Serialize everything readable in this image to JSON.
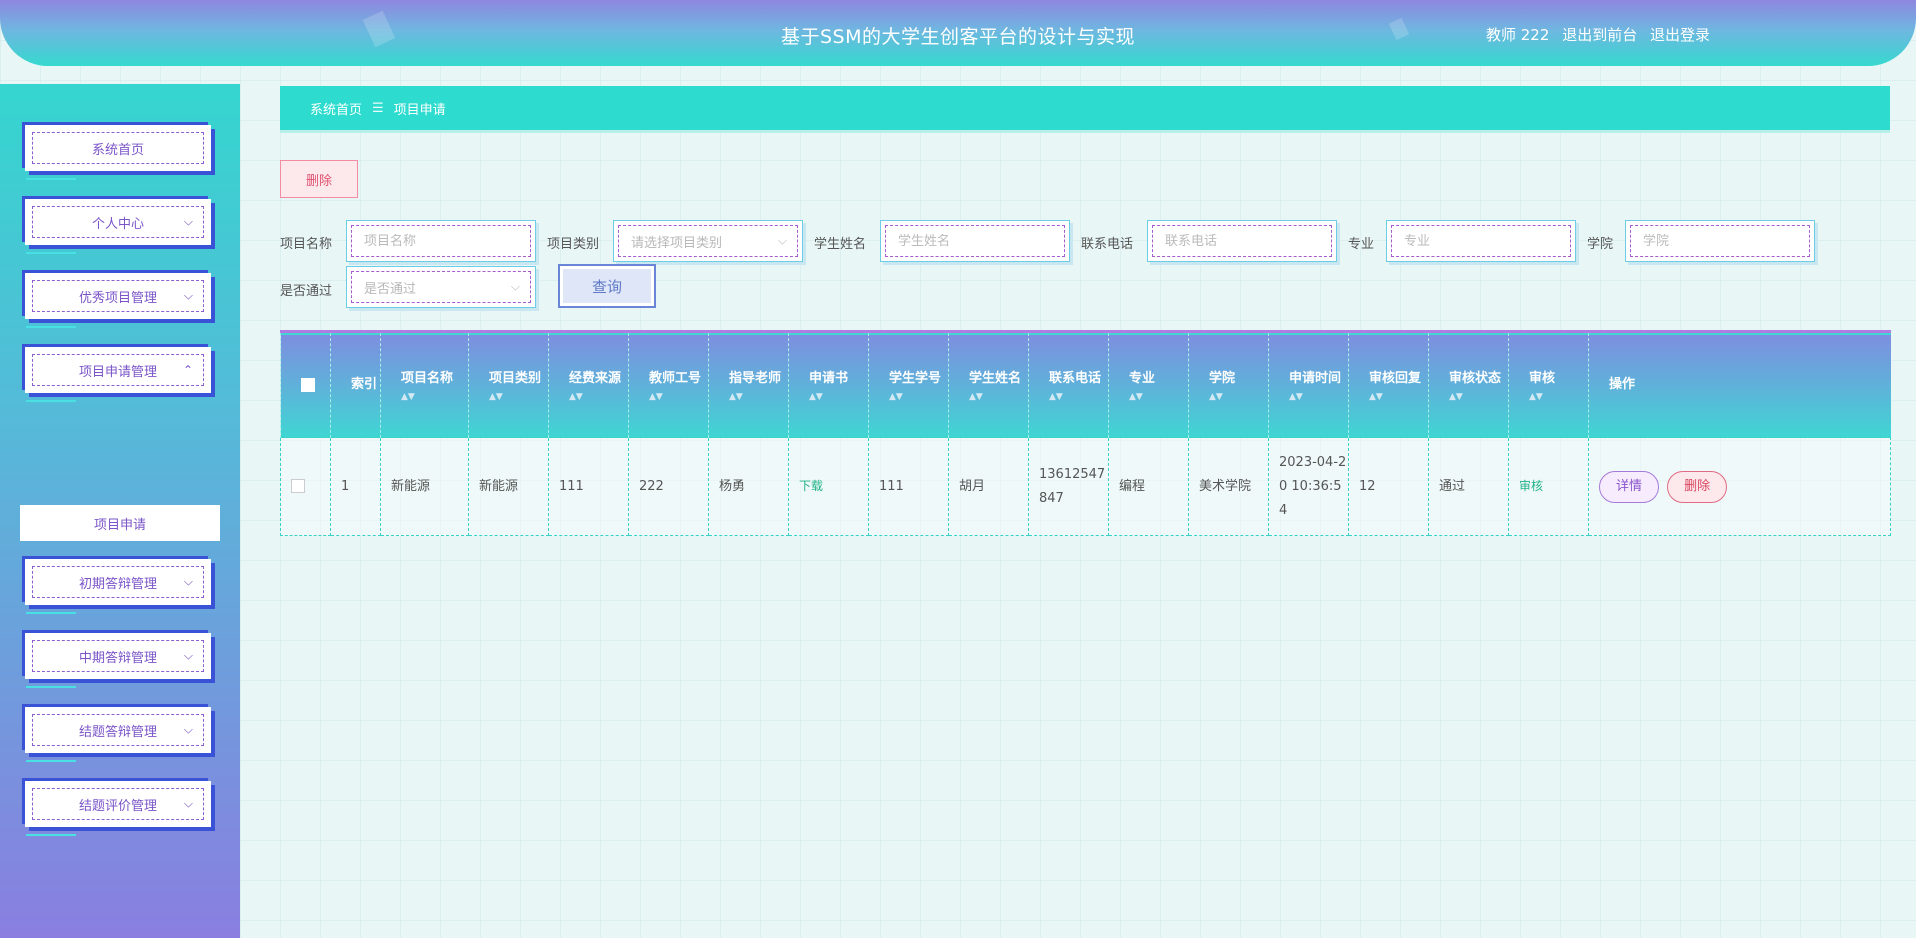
{
  "header": {
    "title": "基于SSM的大学生创客平台的设计与实现",
    "user": "教师 222",
    "front_link": "退出到前台",
    "logout_link": "退出登录"
  },
  "sidebar": {
    "items": [
      {
        "label": "系统首页",
        "has_chevron": false
      },
      {
        "label": "个人中心",
        "chevron": "⌵"
      },
      {
        "label": "优秀项目管理",
        "chevron": "⌵"
      },
      {
        "label": "项目申请管理",
        "chevron": "⌃"
      },
      {
        "label": "初期答辩管理",
        "chevron": "⌵"
      },
      {
        "label": "中期答辩管理",
        "chevron": "⌵"
      },
      {
        "label": "结题答辩管理",
        "chevron": "⌵"
      },
      {
        "label": "结题评价管理",
        "chevron": "⌵"
      }
    ],
    "submenu_label": "项目申请"
  },
  "breadcrumb": {
    "home": "系统首页",
    "separator": "☰",
    "current": "项目申请"
  },
  "toolbar": {
    "delete_label": "删除"
  },
  "filters": {
    "project_name": {
      "label": "项目名称",
      "placeholder": "项目名称"
    },
    "project_type": {
      "label": "项目类别",
      "placeholder": "请选择项目类别"
    },
    "student_name": {
      "label": "学生姓名",
      "placeholder": "学生姓名"
    },
    "phone": {
      "label": "联系电话",
      "placeholder": "联系电话"
    },
    "major": {
      "label": "专业",
      "placeholder": "专业"
    },
    "college": {
      "label": "学院",
      "placeholder": "学院"
    },
    "passed": {
      "label": "是否通过",
      "placeholder": "是否通过"
    },
    "query_label": "查询"
  },
  "table": {
    "headers": {
      "index": "索引",
      "project_name": "项目名称",
      "project_type": "项目类别",
      "fund_source": "经费来源",
      "teacher_no": "教师工号",
      "advisor": "指导老师",
      "application": "申请书",
      "student_no": "学生学号",
      "student_name": "学生姓名",
      "phone": "联系电话",
      "major": "专业",
      "college": "学院",
      "apply_time": "申请时间",
      "review_reply": "审核回复",
      "review_status": "审核状态",
      "review": "审核",
      "actions": "操作"
    },
    "rows": [
      {
        "index": "1",
        "project_name": "新能源",
        "project_type": "新能源",
        "fund_source": "111",
        "teacher_no": "222",
        "advisor": "杨勇",
        "application": "下载",
        "student_no": "111",
        "student_name": "胡月",
        "phone": "13612547847",
        "major": "编程",
        "college": "美术学院",
        "apply_time": "2023-04-20 10:36:54",
        "review_reply": "12",
        "review_status": "通过",
        "review": "审核",
        "detail_label": "详情",
        "delete_label": "删除"
      }
    ]
  },
  "colors": {
    "accent_teal": "#2ddccf",
    "accent_purple": "#8a7ee0",
    "sidebar_frame": "#3a52d6",
    "delete_red": "#e05270"
  }
}
